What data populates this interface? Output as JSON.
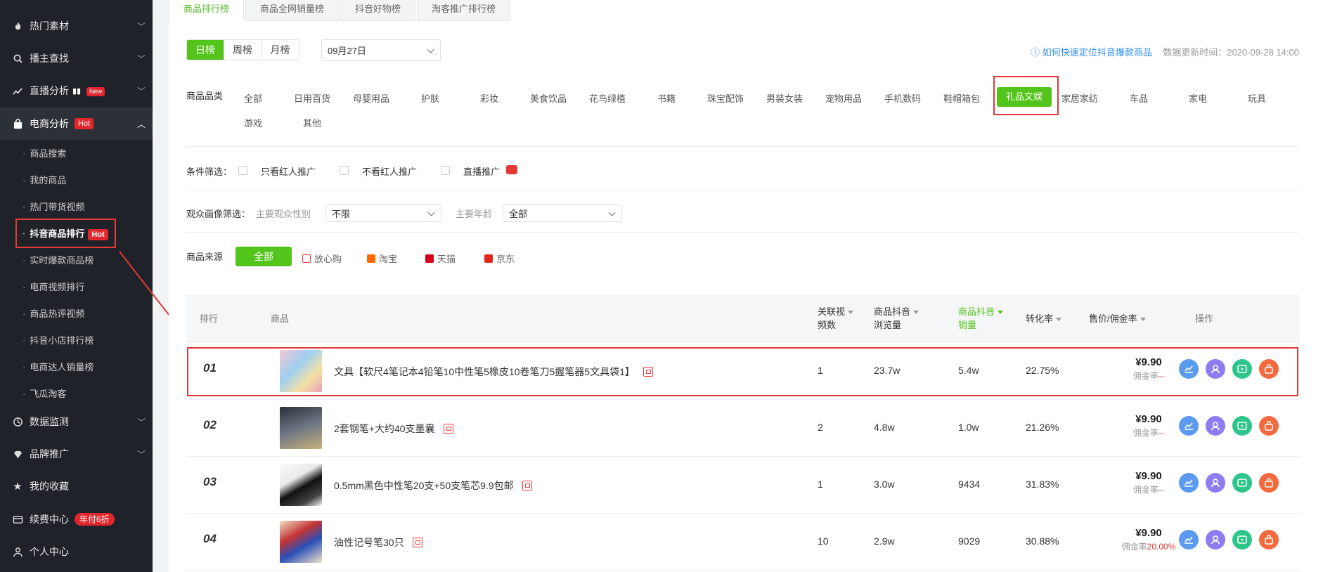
{
  "sidebar": {
    "items": [
      {
        "label": "热门素材",
        "icon": "fire-icon"
      },
      {
        "label": "播主查找",
        "icon": "search-icon"
      },
      {
        "label": "直播分析",
        "icon": "live-chart-icon",
        "badge": "New"
      },
      {
        "label": "电商分析",
        "icon": "shopping-bag-icon",
        "badge": "Hot"
      },
      {
        "label": "数据监测",
        "icon": "monitor-icon"
      },
      {
        "label": "品牌推广",
        "icon": "diamond-icon"
      },
      {
        "label": "我的收藏",
        "icon": "star-icon"
      },
      {
        "label": "续费中心",
        "icon": "card-icon",
        "badge": "年付6折"
      },
      {
        "label": "个人中心",
        "icon": "user-icon"
      }
    ],
    "sub_items": [
      "商品搜索",
      "我的商品",
      "热门带货视频",
      "抖音商品排行",
      "实时爆款商品榜",
      "电商视频排行",
      "商品热评视频",
      "抖音小店排行榜",
      "电商达人销量榜",
      "飞瓜淘客"
    ],
    "sub_badge": "Hot"
  },
  "tabs": [
    "商品排行榜",
    "商品全网销量榜",
    "抖音好物榜",
    "淘客推广排行榜"
  ],
  "period": {
    "options": [
      "日榜",
      "周榜",
      "月榜"
    ],
    "date": "09月27日"
  },
  "help_link": "如何快速定位抖音爆款商品",
  "update_time": "数据更新时间：2020-09-28 14:00",
  "category_label": "商品品类",
  "categories": [
    "全部",
    "日用百货",
    "母婴用品",
    "护肤",
    "彩妆",
    "美食饮品",
    "花鸟绿植",
    "书籍",
    "珠宝配饰",
    "男装女装",
    "宠物用品",
    "手机数码",
    "鞋帽箱包",
    "礼品文娱",
    "家居家纺",
    "车品",
    "家电",
    "玩具",
    "游戏",
    "其他"
  ],
  "category_partial": "鞋帽箱包",
  "filter": {
    "label": "条件筛选：",
    "options": [
      "只看红人推广",
      "不看红人推广",
      "直播推广"
    ]
  },
  "audience": {
    "label": "观众画像筛选：",
    "gender_label": "主要观众性别",
    "gender_value": "不限",
    "age_label": "主要年龄",
    "age_value": "全部"
  },
  "source": {
    "label": "商品来源",
    "all": "全部",
    "options": [
      "放心购",
      "淘宝",
      "天猫",
      "京东"
    ],
    "colors": [
      "#e53935",
      "#ff6a00",
      "#d4001b",
      "#e1251b"
    ]
  },
  "table": {
    "headers": {
      "rank": "排行",
      "product": "商品",
      "videos_1": "关联视",
      "videos_2": "频数",
      "views_1": "商品抖音",
      "views_2": "浏览量",
      "sales_1": "商品抖音",
      "sales_2": "销量",
      "conversion": "转化率",
      "price": "售价/佣金率",
      "ops": "操作"
    },
    "rows": [
      {
        "rank": "01",
        "name": "文具【软尺4笔记本4铅笔10中性笔5橡皮10卷笔刀5握笔器5文具袋1】",
        "videos": "1",
        "views": "23.7w",
        "sales": "5.4w",
        "conversion": "22.75%",
        "price": "¥9.90",
        "commission_label": "佣金率",
        "commission": "--"
      },
      {
        "rank": "02",
        "name": "2套钢笔+大约40支墨囊",
        "videos": "2",
        "views": "4.8w",
        "sales": "1.0w",
        "conversion": "21.26%",
        "price": "¥9.90",
        "commission_label": "佣金率",
        "commission": "--"
      },
      {
        "rank": "03",
        "name": "0.5mm黑色中性笔20支+50支笔芯9.9包邮",
        "videos": "1",
        "views": "3.0w",
        "sales": "9434",
        "conversion": "31.83%",
        "price": "¥9.90",
        "commission_label": "佣金率",
        "commission": "--"
      },
      {
        "rank": "04",
        "name": "油性记号笔30只",
        "videos": "10",
        "views": "2.9w",
        "sales": "9029",
        "conversion": "30.88%",
        "price": "¥9.90",
        "commission_label": "佣金率",
        "commission": "20.00%"
      }
    ]
  },
  "colors": {
    "accent": "#52c41a",
    "highlight": "#e53935",
    "op_trend": "#5b9bef",
    "op_user": "#8f7cf0",
    "op_video": "#2ec58b",
    "op_shop": "#f26a3d"
  }
}
